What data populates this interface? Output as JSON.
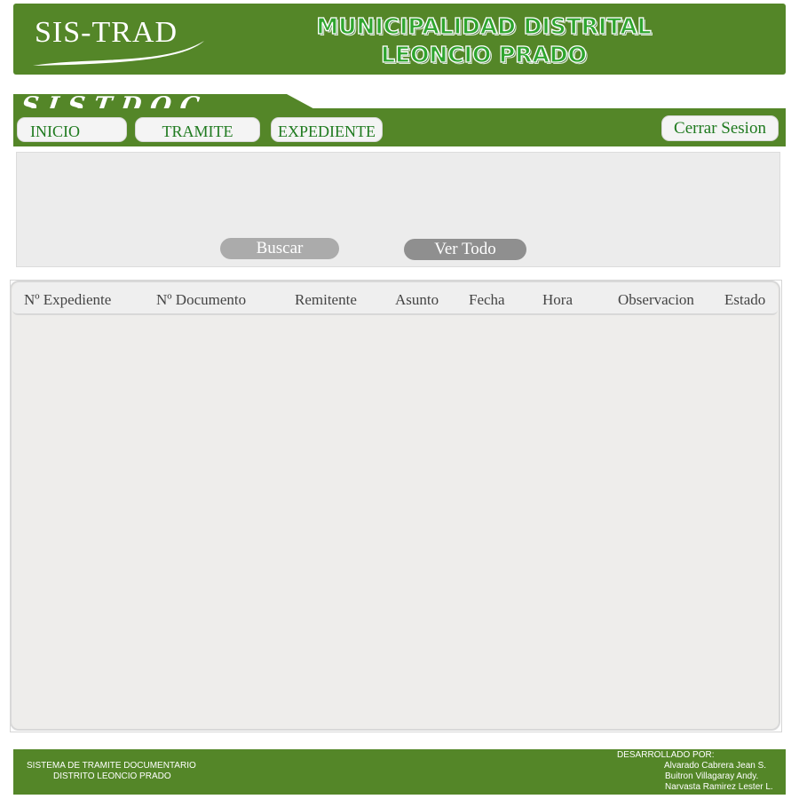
{
  "header": {
    "brand": "SIS-TRAD",
    "title_line1": "MUNICIPALIDAD DISTRITAL",
    "title_line2": "LEONCIO PRADO"
  },
  "app": {
    "name": "SISTDOC"
  },
  "nav": {
    "inicio": "INICIO",
    "tramite": "TRAMITE",
    "expediente": "EXPEDIENTE",
    "logout": "Cerrar Sesion"
  },
  "search": {
    "buscar": "Buscar",
    "ver_todo": "Ver Todo"
  },
  "table": {
    "columns": [
      "Nº Expediente",
      "Nº Documento",
      "Remitente",
      "Asunto",
      "Fecha",
      "Hora",
      "Observacion",
      "Estado"
    ]
  },
  "footer": {
    "left_line1": "SISTEMA DE TRAMITE DOCUMENTARIO",
    "left_line2": "DISTRITO LEONCIO PRADO",
    "dev_label": "DESARROLLADO POR:",
    "dev1": "Alvarado Cabrera Jean S.",
    "dev2": "Buitron Villagaray Andy.",
    "dev3": "Narvasta Ramirez Lester L."
  },
  "colors": {
    "brand_green": "#548628",
    "nav_text": "#1f7a1f"
  }
}
